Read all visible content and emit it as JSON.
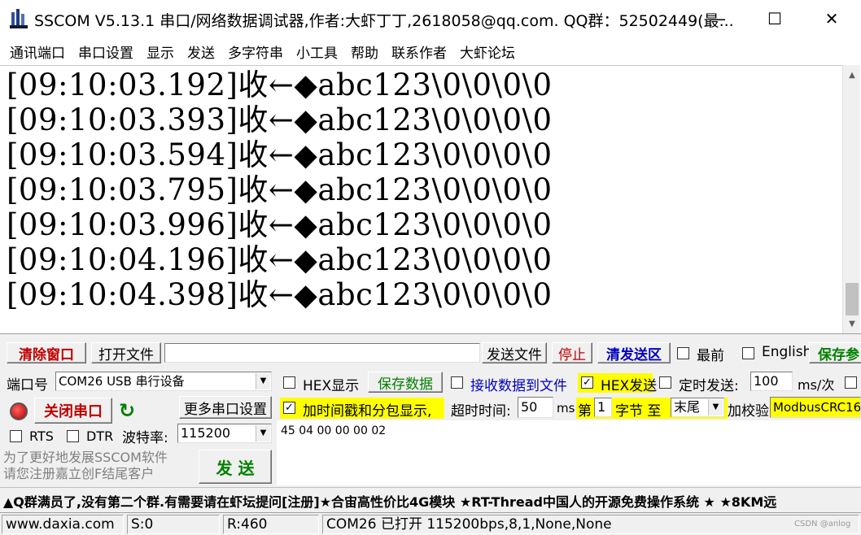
{
  "window": {
    "title": "SSCOM V5.13.1 串口/网络数据调试器,作者:大虾丁丁,2618058@qq.com. QQ群：52502449(最...",
    "minimize": "—",
    "maximize": "☐",
    "close": "✕"
  },
  "menu": [
    "通讯端口",
    "串口设置",
    "显示",
    "发送",
    "多字符串",
    "小工具",
    "帮助",
    "联系作者",
    "大虾论坛"
  ],
  "receive": {
    "lines": [
      "[09:10:03.192]收←◆abc123\\0\\0\\0\\0",
      "[09:10:03.393]收←◆abc123\\0\\0\\0\\0",
      "[09:10:03.594]收←◆abc123\\0\\0\\0\\0",
      "[09:10:03.795]收←◆abc123\\0\\0\\0\\0",
      "[09:10:03.996]收←◆abc123\\0\\0\\0\\0",
      "[09:10:04.196]收←◆abc123\\0\\0\\0\\0",
      "[09:10:04.398]收←◆abc123\\0\\0\\0\\0"
    ]
  },
  "toolbar": {
    "clear_window": "清除窗口",
    "open_file": "打开文件",
    "file_path": "",
    "send_file": "发送文件",
    "stop": "停止",
    "clear_send": "清发送区",
    "topmost_label": "最前",
    "english_label": "English",
    "save_params": "保存参"
  },
  "port": {
    "label": "端口号",
    "value": "COM26 USB 串行设备",
    "close_port": "关闭串口",
    "more_settings": "更多串口设置",
    "rts": "RTS",
    "dtr": "DTR",
    "baud_label": "波特率:",
    "baud_value": "115200"
  },
  "options": {
    "hex_display": "HEX显示",
    "save_data": "保存数据",
    "recv_to_file": "接收数据到文件",
    "hex_send": "HEX发送",
    "timed_send": "定时发送:",
    "interval": "100",
    "interval_unit": "ms/次",
    "timestamp": "加时间戳和分包显示,",
    "timeout_label": "超时时间:",
    "timeout_value": "50",
    "ms": "ms",
    "nth": "第",
    "byte_index": "1",
    "byte_to": "字节 至",
    "end": "末尾",
    "checksum": "加校验",
    "checksum_type": "ModbusCRC16"
  },
  "send": {
    "data": "45 04 00 00 00 02",
    "button": "发 送",
    "promo": "为了更好地发展SSCOM软件\n请您注册嘉立创F结尾客户"
  },
  "ticker": "▲Q群满员了,没有第二个群.有需要请在虾坛提问[注册]★合宙高性价比4G模块 ★RT-Thread中国人的开源免费操作系统 ★ ★8KM远",
  "status": {
    "site": "www.daxia.com",
    "sent": "S:0",
    "received": "R:460",
    "port_state": "COM26 已打开  115200bps,8,1,None,None",
    "watermark": "CSDN @anlog"
  }
}
